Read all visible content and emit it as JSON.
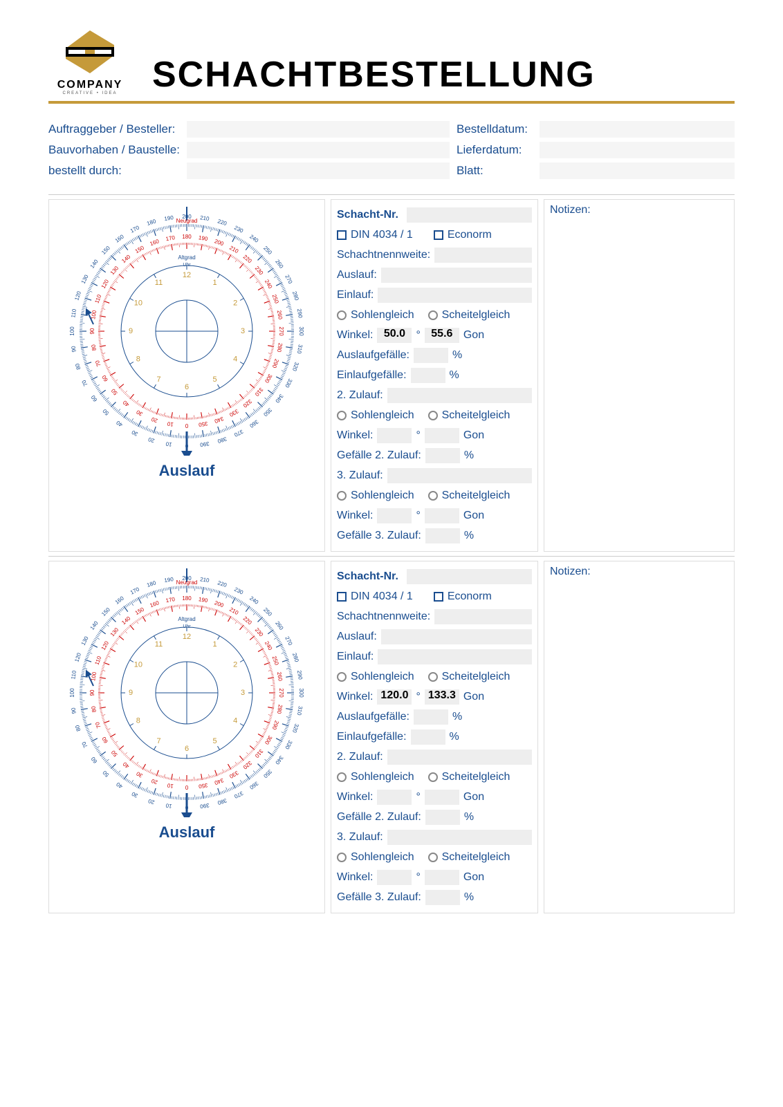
{
  "header": {
    "logo_company": "COMPANY",
    "logo_tagline": "CREATIVE • IDEA",
    "title": "SCHACHTBESTELLUNG"
  },
  "meta": {
    "auftraggeber_label": "Auftraggeber / Besteller:",
    "bauvorhaben_label": "Bauvorhaben / Baustelle:",
    "bestellt_label": "bestellt durch:",
    "bestelldatum_label": "Bestelldatum:",
    "lieferdatum_label": "Lieferdatum:",
    "blatt_label": "Blatt:"
  },
  "labels": {
    "schacht_nr": "Schacht-Nr.",
    "din": "DIN 4034 / 1",
    "econorm": "Econorm",
    "schachtnennweite": "Schachtnennweite:",
    "auslauf": "Auslauf:",
    "einlauf": "Einlauf:",
    "sohlengleich": "Sohlengleich",
    "scheitelgleich": "Scheitelgleich",
    "winkel": "Winkel:",
    "auslaufgefaelle": "Auslaufgefälle:",
    "einlaufgefaelle": "Einlaufgefälle:",
    "zulauf2": "2. Zulauf:",
    "zulauf3": "3. Zulauf:",
    "gef2": "Gefälle 2. Zulauf:",
    "gef3": "Gefälle 3. Zulauf:",
    "notizen": "Notizen:",
    "deg": "°",
    "gon": "Gon",
    "pct": "%"
  },
  "dial": {
    "caption": "Auslauf",
    "neugrad": "Neugrad",
    "altgrad": "Altgrad",
    "uhr": "Uhr",
    "outer_ticks": [
      "140",
      "150",
      "160",
      "170",
      "180",
      "190",
      "200",
      "210",
      "220",
      "230",
      "240",
      "250",
      "260",
      "270",
      "280",
      "290",
      "300",
      "310",
      "320",
      "330",
      "340",
      "350",
      "360",
      "370",
      "380",
      "390",
      "0",
      "10",
      "20",
      "30",
      "40",
      "50",
      "60",
      "70",
      "80",
      "90",
      "100",
      "110",
      "120",
      "130"
    ],
    "inner_ticks_red": [
      "130",
      "140",
      "150",
      "160",
      "170",
      "180",
      "190",
      "200",
      "210",
      "220",
      "230",
      "240",
      "250",
      "260",
      "270",
      "280",
      "290",
      "300",
      "310",
      "320",
      "330",
      "340",
      "350",
      "0",
      "10",
      "20",
      "30",
      "40",
      "50",
      "60",
      "70",
      "80",
      "90",
      "100",
      "110",
      "120"
    ],
    "clock_numbers": [
      "12",
      "1",
      "2",
      "3",
      "4",
      "5",
      "6",
      "7",
      "8",
      "9",
      "10",
      "11"
    ]
  },
  "shafts": [
    {
      "winkel_deg": "50.0",
      "winkel_gon": "55.6"
    },
    {
      "winkel_deg": "120.0",
      "winkel_gon": "133.3"
    }
  ]
}
